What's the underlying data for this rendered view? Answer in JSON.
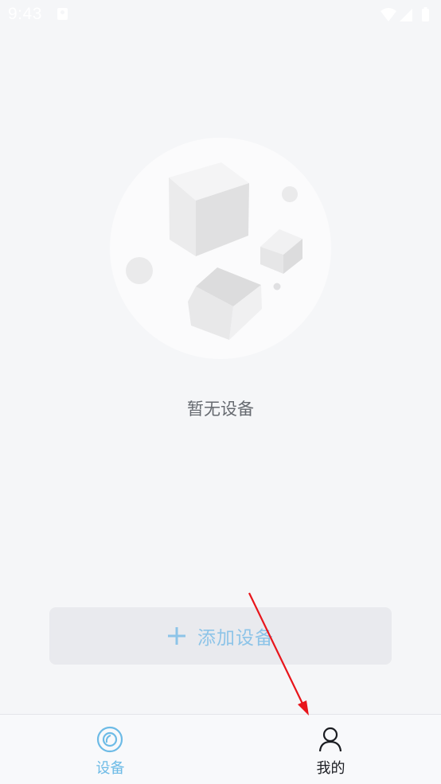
{
  "status_bar": {
    "time": "9:43",
    "icons": [
      "notification-icon",
      "wifi-icon",
      "cellular-signal-icon",
      "battery-icon"
    ]
  },
  "empty_state": {
    "illustration": "empty-box-illustration",
    "message": "暂无设备"
  },
  "add_device": {
    "icon": "plus-icon",
    "label": "添加设备"
  },
  "tab_bar": {
    "tabs": [
      {
        "label": "设备",
        "icon": "device-camera-icon",
        "active": true
      },
      {
        "label": "我的",
        "icon": "user-profile-icon",
        "active": false
      }
    ]
  },
  "colors": {
    "background": "#f5f6f8",
    "accent": "#6dbbe6",
    "button_background": "#e9eaee",
    "button_text": "#8dc4e8",
    "annotation_arrow": "#e8151b"
  }
}
